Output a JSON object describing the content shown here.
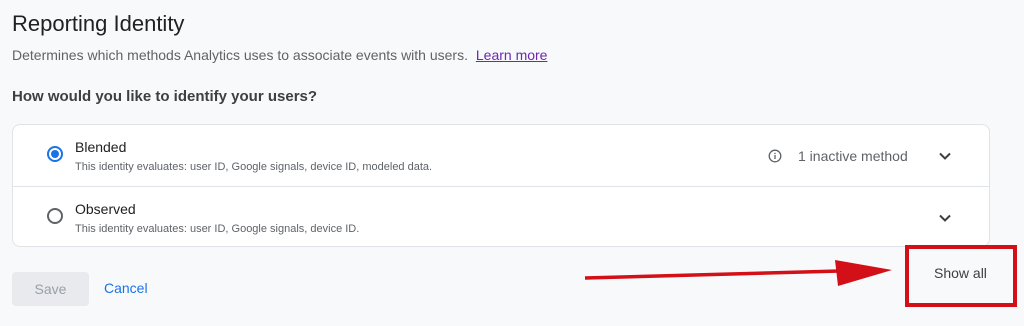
{
  "section": {
    "title": "Reporting Identity",
    "description": "Determines which methods Analytics uses to associate events with users.",
    "learn_more": "Learn more",
    "question": "How would you like to identify your users?"
  },
  "options": [
    {
      "label": "Blended",
      "description": "This identity evaluates: user ID, Google signals, device ID, modeled data.",
      "selected": true,
      "status": "1 inactive method"
    },
    {
      "label": "Observed",
      "description": "This identity evaluates: user ID, Google signals, device ID.",
      "selected": false
    }
  ],
  "actions": {
    "save": "Save",
    "cancel": "Cancel",
    "show_all": "Show all"
  },
  "colors": {
    "accent": "#1a73e8",
    "annotation": "#d30f17",
    "link": "#6f27b4"
  }
}
